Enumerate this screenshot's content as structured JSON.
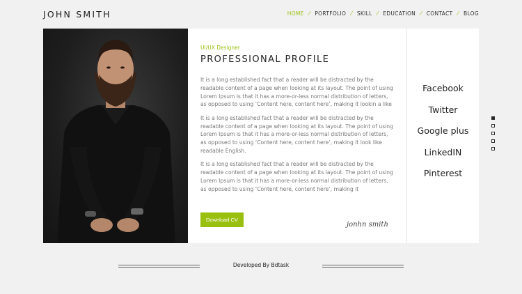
{
  "site": {
    "logo": "JOHN SMITH"
  },
  "nav": {
    "items": [
      "HOME",
      "PORTFOLIO",
      "SKILL",
      "EDUCATION",
      "CONTACT",
      "BLOG"
    ],
    "active": "HOME",
    "separator": "⁄"
  },
  "profile": {
    "role": "UI/UX Designer",
    "title": "PROFESSIONAL PROFILE",
    "paragraphs": [
      "It is a long established fact that a reader will be distracted by the readable content of a page when looking at its layout. The point of using Lorem Ipsum is that it has a more-or-less normal distribution of letters, as opposed to using ‘Content here, content here’, making it lookin a like",
      "It is a long established fact that a reader will be distracted by the readable content of a page when looking at its layout. The point of using Lorem Ipsum is that it has a more-or-less normal distribution of letters, as opposed to using ‘Content here, content here’, making it look like readable English.",
      "It is a long established fact that a reader will be distracted by the readable content of a page when looking at its layout. The point of using Lorem Ipsum is that it has a more-or-less normal distribution of letters, as opposed to using ‘Content here, content here’, making it"
    ],
    "download_label": "Download CV",
    "signature": "jonhn smith"
  },
  "social": [
    "Facebook",
    "Twitter",
    "Google plus",
    "LinkedIN",
    "Pinterest"
  ],
  "pager": {
    "count": 5,
    "active_index": 0
  },
  "footer": {
    "credit": "Developed By Bdtask"
  },
  "colors": {
    "accent": "#9ac00f",
    "background": "#f1f1f1"
  }
}
